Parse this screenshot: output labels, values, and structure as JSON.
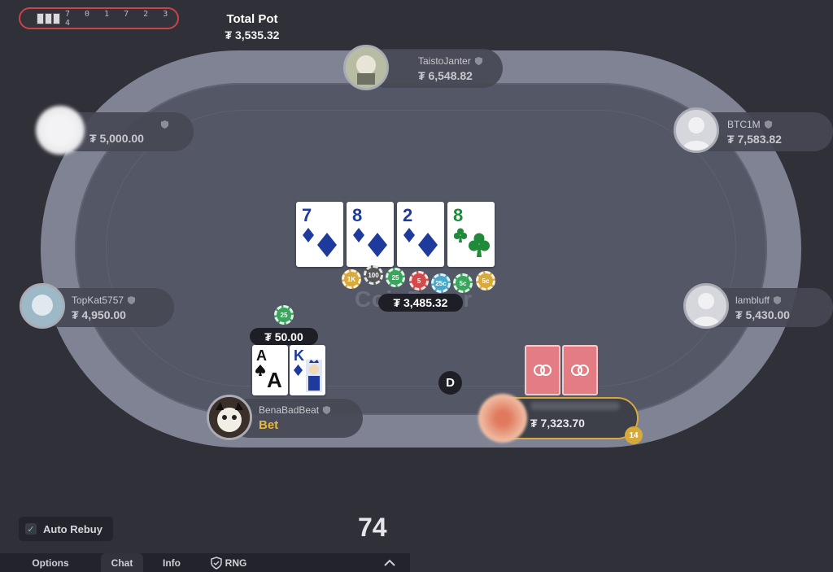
{
  "hand_id": {
    "digits": "7 0 1 7 2 3 4"
  },
  "total_pot": {
    "label": "Total Pot",
    "amount": "₮ 3,535.32"
  },
  "table": {
    "watermark": "CoinPoker"
  },
  "players": {
    "top": {
      "name": "TaistoJanter",
      "stack": "₮ 6,548.82"
    },
    "left_upper": {
      "name": "",
      "stack": "₮ 5,000.00"
    },
    "right_upper": {
      "name": "BTC1M",
      "stack": "₮ 7,583.82"
    },
    "left_lower": {
      "name": "TopKat5757",
      "stack": "₮ 4,950.00"
    },
    "right_lower": {
      "name": "lambluff",
      "stack": "₮ 5,430.00"
    },
    "bottom_left": {
      "name": "BenaBadBeat",
      "action": "Bet",
      "bet": "₮ 50.00",
      "bet_chip": "25"
    },
    "hero": {
      "stack": "₮ 7,323.70",
      "badge": "14"
    }
  },
  "community_cards": [
    {
      "rank": "7",
      "suit": "diamond",
      "color": "#1d3a9c"
    },
    {
      "rank": "8",
      "suit": "diamond",
      "color": "#1d3a9c"
    },
    {
      "rank": "2",
      "suit": "diamond",
      "color": "#1d3a9c"
    },
    {
      "rank": "8",
      "suit": "club",
      "color": "#1f8a3a"
    }
  ],
  "hole_cards": [
    {
      "rank": "A",
      "suit": "spade"
    },
    {
      "rank": "K",
      "suit": "diamond"
    }
  ],
  "pot_chips": [
    "1K",
    "100",
    "25",
    "5",
    "25c",
    "5c",
    "5c"
  ],
  "pot_amount": "₮ 3,485.32",
  "dealer_button": "D",
  "auto_rebuy": {
    "label": "Auto Rebuy",
    "checked": true
  },
  "timer": "74",
  "tabs": [
    "Options",
    "Chat",
    "Info",
    "RNG"
  ],
  "active_tab": "Chat",
  "colors": {
    "accent_gold": "#d7a93a",
    "felt": "#545866",
    "rail": "#7f8394"
  }
}
